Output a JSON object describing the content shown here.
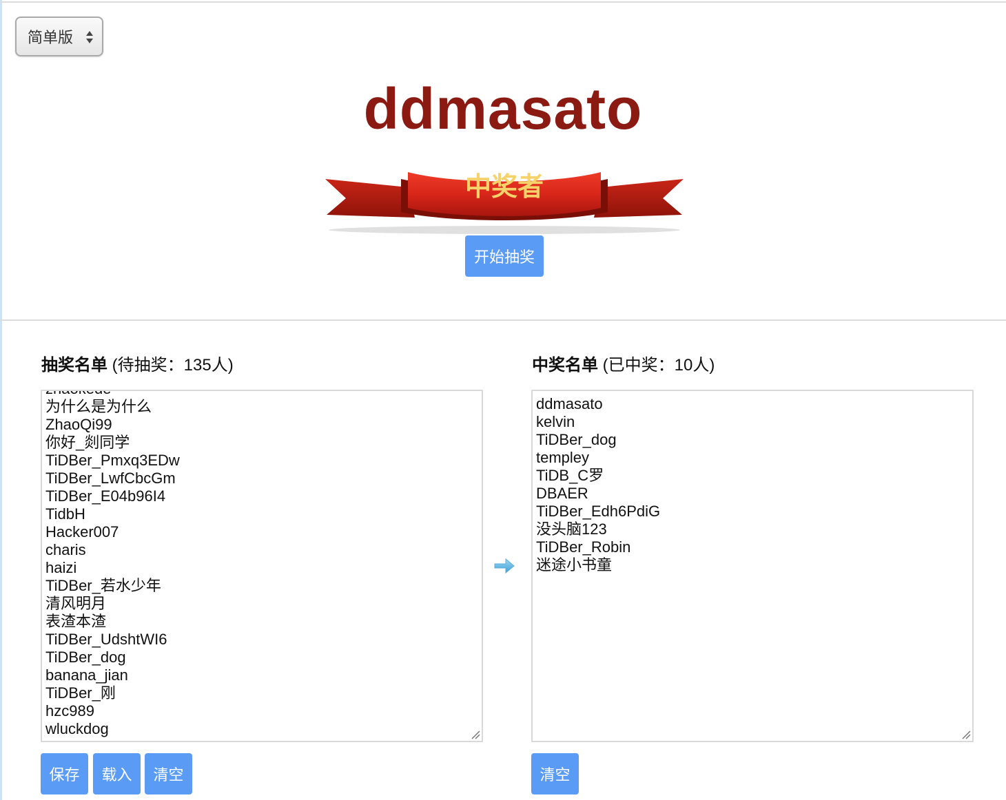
{
  "mode_select": {
    "value": "简单版"
  },
  "winner": {
    "name": "ddmasato",
    "banner_text": "中奖者"
  },
  "start_button": {
    "label": "开始抽奖"
  },
  "pending": {
    "title": "抽奖名单",
    "count_text": "(待抽奖：135人)",
    "partial_top_item": "zhaokede",
    "items": [
      "为什么是为什么",
      "ZhaoQi99",
      "你好_剡同学",
      "TiDBer_Pmxq3EDw",
      "TiDBer_LwfCbcGm",
      "TiDBer_E04b96I4",
      "TidbH",
      "Hacker007",
      "charis",
      "haizi",
      "TiDBer_若水少年",
      "清风明月",
      "表渣本渣",
      "TiDBer_UdshtWI6",
      "TiDBer_dog",
      "banana_jian",
      "TiDBer_刚",
      "hzc989",
      "wluckdog"
    ],
    "buttons": {
      "save": "保存",
      "load": "载入",
      "clear": "清空"
    }
  },
  "winners": {
    "title": "中奖名单",
    "count_text": "(已中奖：10人)",
    "items": [
      "ddmasato",
      "kelvin",
      "TiDBer_dog",
      "templey",
      "TiDB_C罗",
      "DBAER",
      "TiDBer_Edh6PdiG",
      "没头脑123",
      "TiDBer_Robin",
      "迷途小书童"
    ],
    "buttons": {
      "clear": "清空"
    }
  },
  "icons": {
    "transfer": "arrow-right-icon",
    "select": "select-arrows-icon",
    "resize": "resize-grip-icon"
  },
  "colors": {
    "accent": "#5a9cf5",
    "winner_name": "#8b1a12",
    "ribbon": "#d8261a",
    "banner_text": "#f6d36a"
  }
}
